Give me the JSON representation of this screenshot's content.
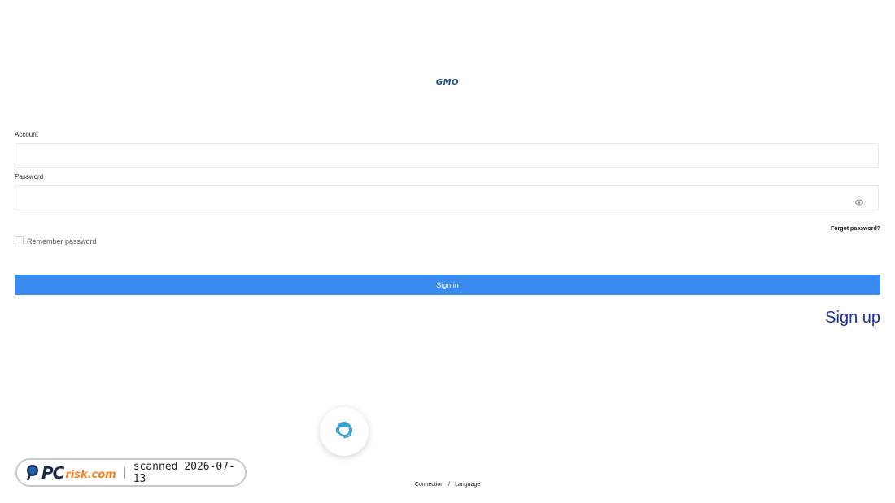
{
  "logo": {
    "text": "GMO"
  },
  "form": {
    "account_label": "Account",
    "account_value": "",
    "password_label": "Password",
    "password_value": "",
    "forgot_label": "Forgot password?",
    "remember_label": "Remember password",
    "remember_checked": false,
    "signin_label": "Sign in",
    "signup_label": "Sign up"
  },
  "icons": {
    "eye": "eye-icon",
    "support": "headset-support-icon"
  },
  "badge": {
    "brand_pc": "PC",
    "brand_risk": "risk.com",
    "scan_text": "scanned 2026-07-13"
  },
  "footer": {
    "connection": "Connection",
    "separator": "/",
    "language": "Language"
  },
  "colors": {
    "primary": "#3b8af0",
    "signup": "#1a2fa8",
    "logo": "#1a4f8c",
    "support": "#3aa0d8",
    "badge_accent": "#f08020"
  }
}
